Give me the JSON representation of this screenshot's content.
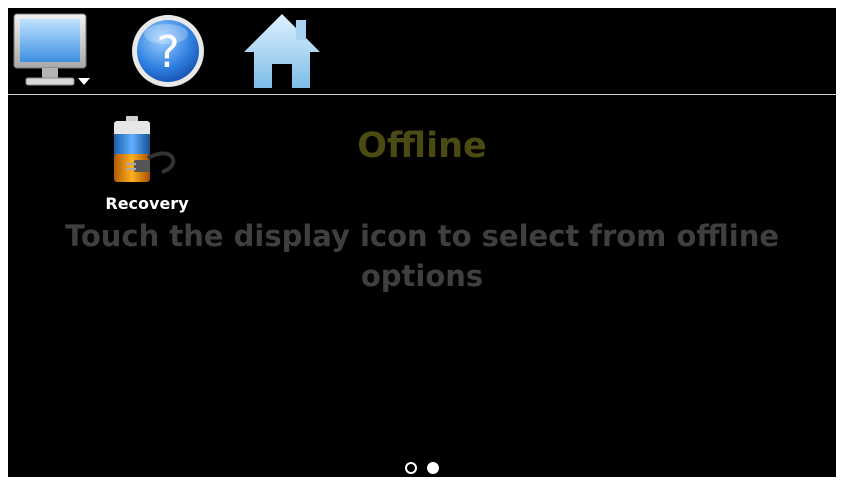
{
  "toolbar": {
    "buttons": [
      {
        "icon": "monitor-icon",
        "label": ""
      },
      {
        "icon": "help-icon",
        "label": ""
      },
      {
        "icon": "home-icon",
        "label": ""
      }
    ]
  },
  "apps": [
    {
      "icon": "battery-plug-icon",
      "label": "Recovery"
    }
  ],
  "status": {
    "title": "Offline",
    "message": "Touch the display icon to select from offline options"
  },
  "pager": {
    "pages": 2,
    "current": 2
  },
  "colors": {
    "background": "#000000",
    "divider": "#cfcfcf",
    "title": "#4a4a12",
    "message": "#3f3f3f",
    "label": "#ffffff"
  }
}
